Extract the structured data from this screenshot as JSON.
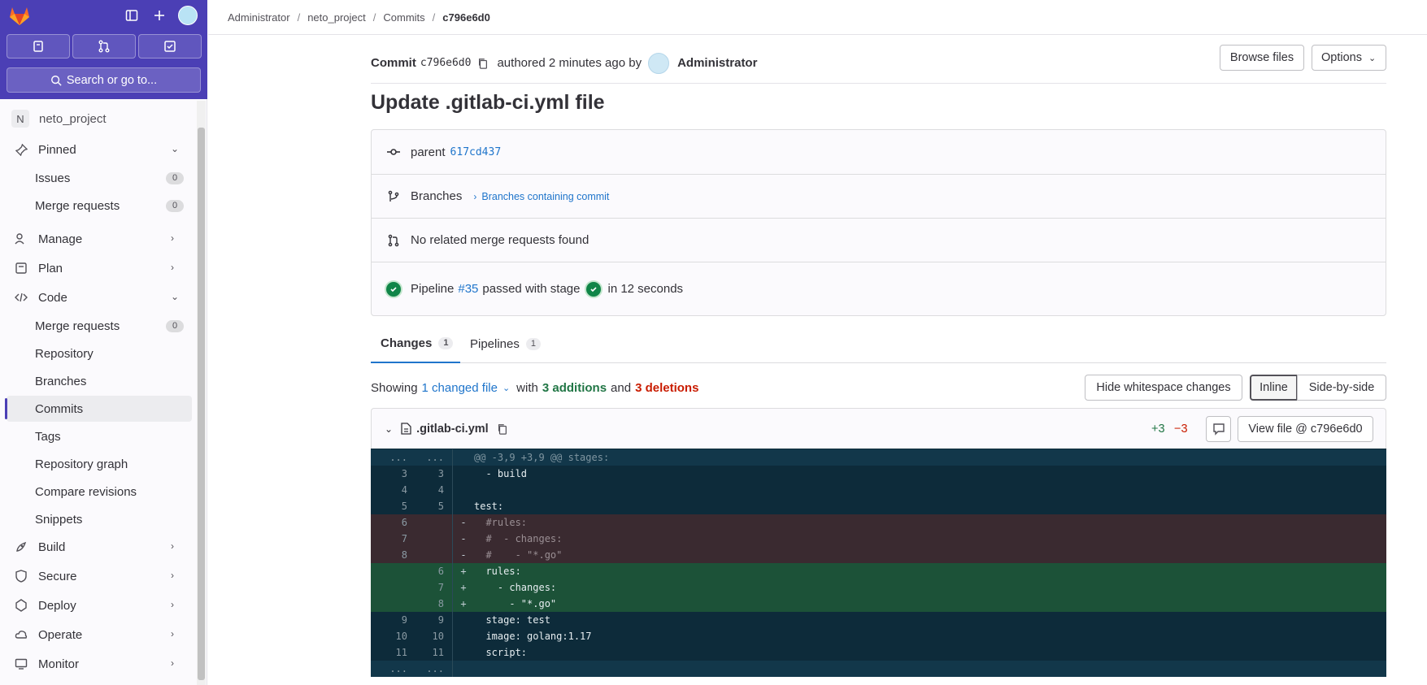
{
  "sidebar": {
    "search_label": "Search or go to...",
    "project": "neto_project",
    "items": [
      {
        "label": "Pinned",
        "icon": "pin-icon"
      },
      {
        "label": "Issues",
        "count": "0"
      },
      {
        "label": "Merge requests",
        "count": "0"
      },
      {
        "label": "Manage",
        "icon": "users-icon"
      },
      {
        "label": "Plan",
        "icon": "plan-icon"
      },
      {
        "label": "Code",
        "icon": "code-icon"
      },
      {
        "label": "Merge requests",
        "count": "0"
      },
      {
        "label": "Repository"
      },
      {
        "label": "Branches"
      },
      {
        "label": "Commits"
      },
      {
        "label": "Tags"
      },
      {
        "label": "Repository graph"
      },
      {
        "label": "Compare revisions"
      },
      {
        "label": "Snippets"
      },
      {
        "label": "Build",
        "icon": "rocket-icon"
      },
      {
        "label": "Secure",
        "icon": "shield-icon"
      },
      {
        "label": "Deploy",
        "icon": "deploy-icon"
      },
      {
        "label": "Operate",
        "icon": "cloud-icon"
      },
      {
        "label": "Monitor",
        "icon": "monitor-icon"
      }
    ]
  },
  "breadcrumb": [
    "Administrator",
    "neto_project",
    "Commits",
    "c796e6d0"
  ],
  "commit": {
    "label": "Commit",
    "sha": "c796e6d0",
    "authored": "authored 2 minutes ago by",
    "author": "Administrator",
    "browse_files": "Browse files",
    "options": "Options",
    "title": "Update .gitlab-ci.yml file",
    "parent_label": "parent",
    "parent_sha": "617cd437",
    "branches_label": "Branches",
    "branches_link": "Branches containing commit",
    "mr_text": "No related merge requests found",
    "pipeline_label": "Pipeline",
    "pipeline_id": "#35",
    "pipeline_status": "passed with stage",
    "pipeline_duration": "in 12 seconds"
  },
  "tabs": [
    {
      "label": "Changes",
      "count": "1"
    },
    {
      "label": "Pipelines",
      "count": "1"
    }
  ],
  "summary": {
    "showing": "Showing",
    "changed": "1 changed file",
    "with": "with",
    "additions": "3 additions",
    "and": "and",
    "deletions": "3 deletions",
    "hide_ws": "Hide whitespace changes",
    "inline": "Inline",
    "side_by_side": "Side-by-side"
  },
  "file": {
    "name": ".gitlab-ci.yml",
    "added": "+3",
    "removed": "−3",
    "view_file": "View file @ c796e6d0"
  },
  "diff": [
    {
      "type": "hunk",
      "old": "...",
      "new": "...",
      "sign": "",
      "code": "@@ -3,9 +3,9 @@ stages:"
    },
    {
      "type": "ctx",
      "old": "3",
      "new": "3",
      "sign": "",
      "code": "  - build"
    },
    {
      "type": "ctx",
      "old": "4",
      "new": "4",
      "sign": "",
      "code": ""
    },
    {
      "type": "ctx",
      "old": "5",
      "new": "5",
      "sign": "",
      "code": "test:"
    },
    {
      "type": "del",
      "old": "6",
      "new": "",
      "sign": "-",
      "code": "  #rules:"
    },
    {
      "type": "del",
      "old": "7",
      "new": "",
      "sign": "-",
      "code": "  #  - changes:"
    },
    {
      "type": "del",
      "old": "8",
      "new": "",
      "sign": "-",
      "code": "  #    - \"*.go\""
    },
    {
      "type": "add",
      "old": "",
      "new": "6",
      "sign": "+",
      "code": "  rules:"
    },
    {
      "type": "add",
      "old": "",
      "new": "7",
      "sign": "+",
      "code": "    - changes:"
    },
    {
      "type": "add",
      "old": "",
      "new": "8",
      "sign": "+",
      "code": "      - \"*.go\""
    },
    {
      "type": "ctx",
      "old": "9",
      "new": "9",
      "sign": "",
      "code": "  stage: test"
    },
    {
      "type": "ctx",
      "old": "10",
      "new": "10",
      "sign": "",
      "code": "  image: golang:1.17"
    },
    {
      "type": "ctx",
      "old": "11",
      "new": "11",
      "sign": "",
      "code": "  script:"
    },
    {
      "type": "hunk",
      "old": "...",
      "new": "...",
      "sign": "",
      "code": ""
    }
  ]
}
